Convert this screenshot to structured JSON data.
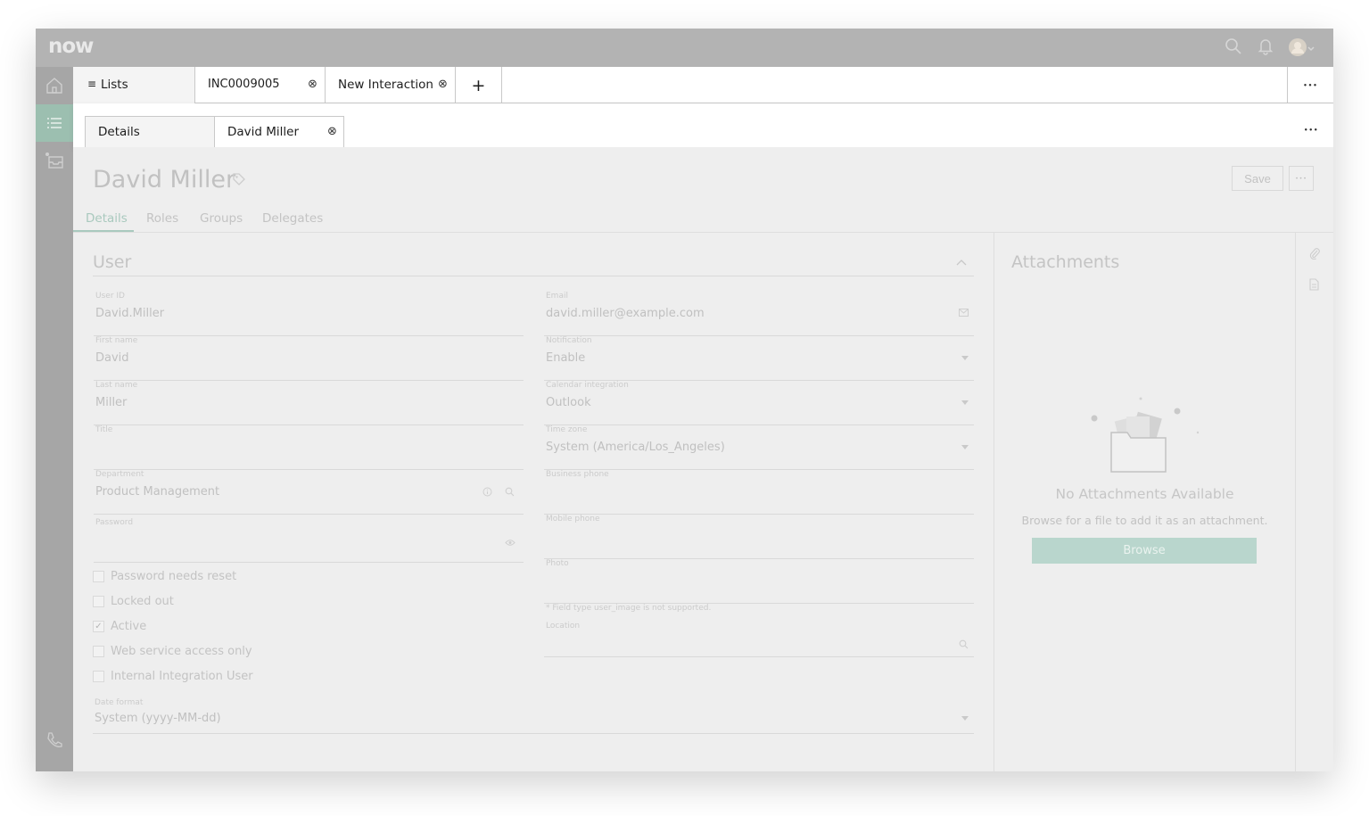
{
  "app": {
    "logo": "now"
  },
  "header": {
    "search_icon": "search-icon",
    "bell_icon": "bell-icon",
    "avatar_icon": "avatar-icon"
  },
  "rail": {
    "items": [
      "home-icon",
      "list-icon",
      "inbox-icon",
      "phone-icon"
    ]
  },
  "tabs": [
    {
      "label": "Lists",
      "icon": "list-icon"
    },
    {
      "label": "INC0009005"
    },
    {
      "label": "New Interaction"
    }
  ],
  "tabbar": {
    "add_glyph": "+",
    "more_glyph": "•••"
  },
  "subtabs": [
    {
      "label": "Details"
    },
    {
      "label": "David Miller"
    }
  ],
  "record": {
    "title": "David Miller",
    "save_label": "Save",
    "tabs": [
      "Details",
      "Roles",
      "Groups",
      "Delegates"
    ]
  },
  "section": {
    "title": "User"
  },
  "fields": {
    "user_id": {
      "label": "User ID",
      "value": "David.Miller"
    },
    "first_name": {
      "label": "First name",
      "value": "David"
    },
    "last_name": {
      "label": "Last name",
      "value": "Miller"
    },
    "title": {
      "label": "Title",
      "value": ""
    },
    "department": {
      "label": "Department",
      "value": "Product Management"
    },
    "password": {
      "label": "Password",
      "value": ""
    },
    "email": {
      "label": "Email",
      "value": "david.miller@example.com"
    },
    "notification": {
      "label": "Notification",
      "value": "Enable"
    },
    "calendar": {
      "label": "Calendar integration",
      "value": "Outlook"
    },
    "timezone": {
      "label": "Time zone",
      "value": "System (America/Los_Angeles)"
    },
    "business_phone": {
      "label": "Business phone",
      "value": ""
    },
    "mobile_phone": {
      "label": "Mobile phone",
      "value": ""
    },
    "photo": {
      "label": "Photo",
      "value": ""
    },
    "photo_note": "* Field type user_image is not supported.",
    "location": {
      "label": "Location",
      "value": ""
    },
    "date_format": {
      "label": "Date format",
      "value": "System (yyyy-MM-dd)"
    }
  },
  "checkboxes": [
    {
      "label": "Password needs reset",
      "checked": false
    },
    {
      "label": "Locked out",
      "checked": false
    },
    {
      "label": "Active",
      "checked": true
    },
    {
      "label": "Web service access only",
      "checked": false
    },
    {
      "label": "Internal Integration User",
      "checked": false
    }
  ],
  "attachments": {
    "title": "Attachments",
    "empty_title": "No Attachments Available",
    "hint": "Browse for a file to add it as an attachment.",
    "browse_label": "Browse"
  },
  "colors": {
    "accent": "#a9c9be",
    "browse_button": "#b9d6cd",
    "rail_active": "#9cbfb0"
  }
}
